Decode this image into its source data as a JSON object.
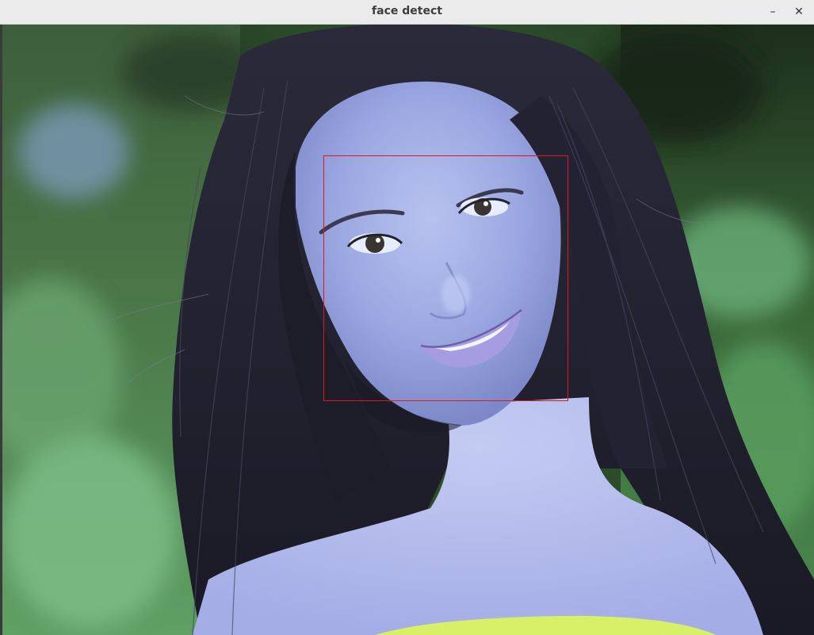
{
  "window": {
    "title": "face detect",
    "minimize_label": "–",
    "close_label": "✕"
  },
  "colors": {
    "detection_box": "#e01818",
    "titlebar": "#ebebeb"
  },
  "image": {
    "icon": "photo-of-woman-with-long-dark-hair",
    "detections": [
      {
        "label": "face",
        "shape": "rectangle"
      }
    ]
  }
}
